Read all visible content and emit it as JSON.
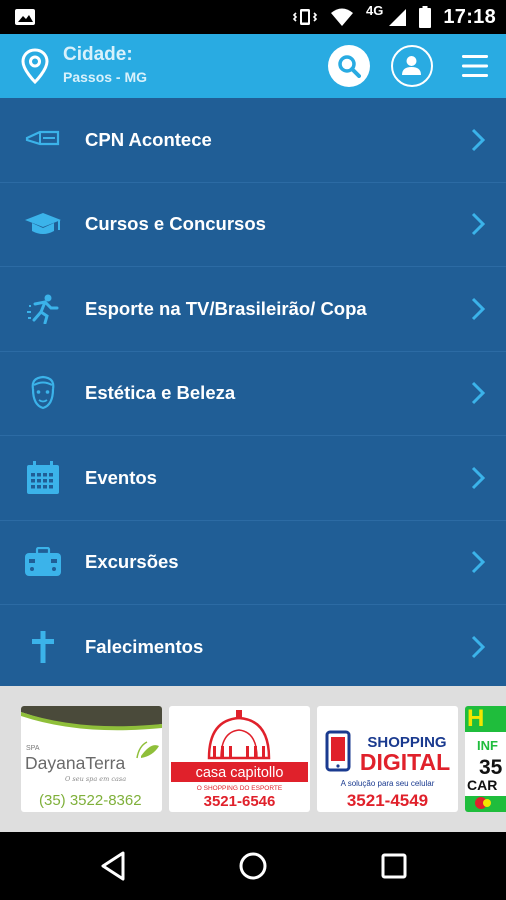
{
  "status_bar": {
    "network": "4G",
    "time": "17:18"
  },
  "header": {
    "city_label": "Cidade:",
    "city_value": "Passos - MG",
    "icons": [
      "location-pin-icon",
      "search-icon",
      "user-icon",
      "hamburger-menu-icon"
    ]
  },
  "menu": {
    "items": [
      {
        "label": "CPN Acontece",
        "icon": "megaphone-icon"
      },
      {
        "label": "Cursos e Concursos",
        "icon": "graduation-cap-icon"
      },
      {
        "label": "Esporte na TV/Brasileirão/ Copa",
        "icon": "runner-icon"
      },
      {
        "label": "Estética e Beleza",
        "icon": "face-icon"
      },
      {
        "label": "Eventos",
        "icon": "calendar-icon"
      },
      {
        "label": "Excursões",
        "icon": "suitcase-icon"
      },
      {
        "label": "Falecimentos",
        "icon": "cross-icon"
      }
    ]
  },
  "ads": [
    {
      "brand_top": "SPA",
      "brand": "DayanaTerra",
      "tagline": "O seu spa em casa",
      "phone": "(35) 3522-8362"
    },
    {
      "brand": "casa capitollo",
      "tagline": "O SHOPPING DO ESPORTE",
      "phone": "3521-6546"
    },
    {
      "brand_top": "SHOPPING",
      "brand": "DIGITAL",
      "tagline": "A solução para seu celular",
      "phone": "3521-4549"
    },
    {
      "brand_top": "H",
      "text1": "INF",
      "text2": "35",
      "text3": "CAR"
    }
  ],
  "colors": {
    "app_bar": "#29abe2",
    "menu_bg": "#205e96",
    "accent_icon": "#3bb3ea",
    "ad_strip": "#dedede"
  }
}
